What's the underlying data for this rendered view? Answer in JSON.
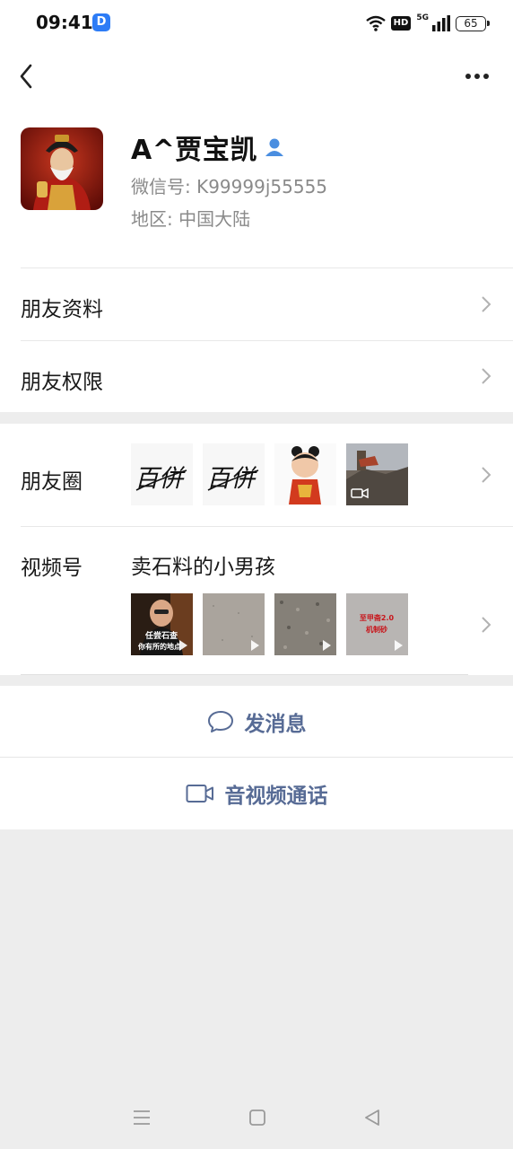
{
  "status_bar": {
    "time": "09:41",
    "app_badge": "D",
    "hd_badge": "HD",
    "network": "5G",
    "battery": "65"
  },
  "profile": {
    "name": "A^贾宝凯",
    "wechat_id": "微信号: K99999j55555",
    "region": "地区: 中国大陆"
  },
  "rows": {
    "friend_info": "朋友资料",
    "friend_permissions": "朋友权限",
    "moments": "朋友圈",
    "channels": "视频号",
    "channels_title": "卖石料的小男孩"
  },
  "channel_thumbs": {
    "first_caption_1": "任尝石查",
    "first_caption_2": "你有所的地点",
    "fourth_caption_1": "至甲斋2.0",
    "fourth_caption_2": "机制砂"
  },
  "moments_thumbs": {
    "signature": "百併"
  },
  "actions": {
    "send_message": "发消息",
    "video_call": "音视频通话"
  },
  "colors": {
    "link_blue": "#576b95",
    "page_bg": "#ededed",
    "muted_text": "#8a8a8a"
  }
}
